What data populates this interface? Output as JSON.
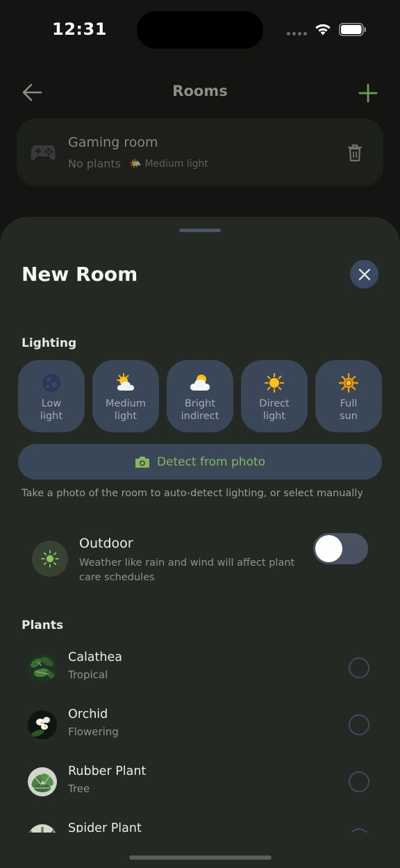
{
  "status_bar": {
    "time": "12:31"
  },
  "header": {
    "title": "Rooms",
    "back_icon": "arrow-left-icon",
    "add_icon": "plus-icon",
    "accent_color": "#6da34d"
  },
  "rooms": [
    {
      "name": "Gaming room",
      "plants_label": "No plants",
      "light_emoji": "🌤️",
      "light_label": "Medium light",
      "icon": "gamepad-icon"
    }
  ],
  "sheet": {
    "title": "New Room",
    "lighting_label": "Lighting",
    "lighting_options": [
      {
        "emoji": "🌑",
        "label": "Low\nlight"
      },
      {
        "emoji": "🌤️",
        "label": "Medium\nlight"
      },
      {
        "emoji": "🌥️",
        "label": "Bright\nindirect"
      },
      {
        "emoji": "☀️",
        "label": "Direct\nlight"
      },
      {
        "emoji": "🔆",
        "label": "Full\nsun"
      }
    ],
    "detect_button": "Detect from photo",
    "detect_hint": "Take a photo of the room to auto-detect lighting, or select manually",
    "outdoor": {
      "title": "Outdoor",
      "description": "Weather like rain and wind will affect plant care schedules",
      "enabled": false
    },
    "plants_label": "Plants",
    "plants": [
      {
        "name": "Calathea",
        "category": "Tropical",
        "selected": false
      },
      {
        "name": "Orchid",
        "category": "Flowering",
        "selected": false
      },
      {
        "name": "Rubber Plant",
        "category": "Tree",
        "selected": false
      },
      {
        "name": "Spider Plant",
        "category": "",
        "selected": false
      }
    ]
  },
  "colors": {
    "sheet_bg": "#252923",
    "option_bg": "#3a4758",
    "accent_green": "#86b75f"
  }
}
